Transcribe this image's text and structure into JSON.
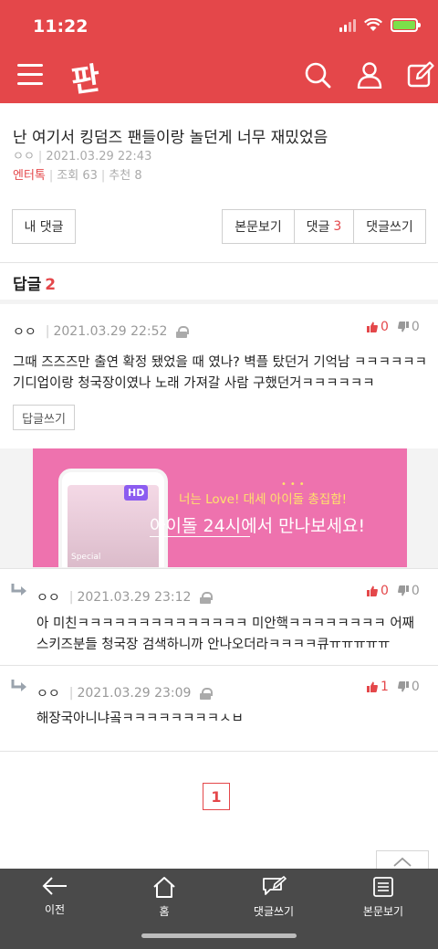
{
  "status": {
    "time": "11:22"
  },
  "header": {
    "logo": "판"
  },
  "post": {
    "title": "난 여기서 킹덤즈 팬들이랑 놀던게 너무 재밌었음",
    "author": "ㅇㅇ",
    "date": "2021.03.29 22:43",
    "category": "엔터톡",
    "views": "조회 63",
    "recommend": "추천 8"
  },
  "actions": {
    "my_comments": "내 댓글",
    "view_post": "본문보기",
    "comments_label": "댓글",
    "comments_count": "3",
    "write_comment": "댓글쓰기"
  },
  "replies": {
    "label": "답글",
    "count": "2"
  },
  "comment_main": {
    "author": "ㅇㅇ",
    "date": "2021.03.29 22:52",
    "up": "0",
    "down": "0",
    "text": "그때 즈즈즈만 출연 확정 됐었을 때 였나? 벽플 탔던거 기억남 ㅋㅋㅋㅋㅋㅋ 기디업이랑 청국장이였나 노래 가져갈 사람 구했던거ㅋㅋㅋㅋㅋㅋ",
    "reply_button": "답글쓰기"
  },
  "ad": {
    "line1": "너는 Love! 대세 아이돌 총집합!",
    "line2": "아이돌 24시에서 만나보세요!",
    "badge": "HD",
    "special": "Special"
  },
  "reply1": {
    "author": "ㅇㅇ",
    "date": "2021.03.29 23:12",
    "up": "0",
    "down": "0",
    "text": "아 미친ㅋㅋㅋㅋㅋㅋㅋㅋㅋㅋㅋㅋㅋㅋ 미안핵ㅋㅋㅋㅋㅋㅋㅋㅋ 어째 스키즈분들 청국장 검색하니까 안나오더라ㅋㅋㅋㅋ큐ㅠㅠㅠㅠㅠ"
  },
  "reply2": {
    "author": "ㅇㅇ",
    "date": "2021.03.29 23:09",
    "up": "1",
    "down": "0",
    "text": "해장국아니냐곸ㅋㅋㅋㅋㅋㅋㅋㅋㅅㅂ"
  },
  "pagination": {
    "current": "1"
  },
  "bottom_nav": {
    "back": "이전",
    "home": "홈",
    "write": "댓글쓰기",
    "view_post": "본문보기"
  },
  "colors": {
    "brand": "#e4474a",
    "nav_bg": "#4a4a4a",
    "ad_bg": "#ee72ae"
  }
}
